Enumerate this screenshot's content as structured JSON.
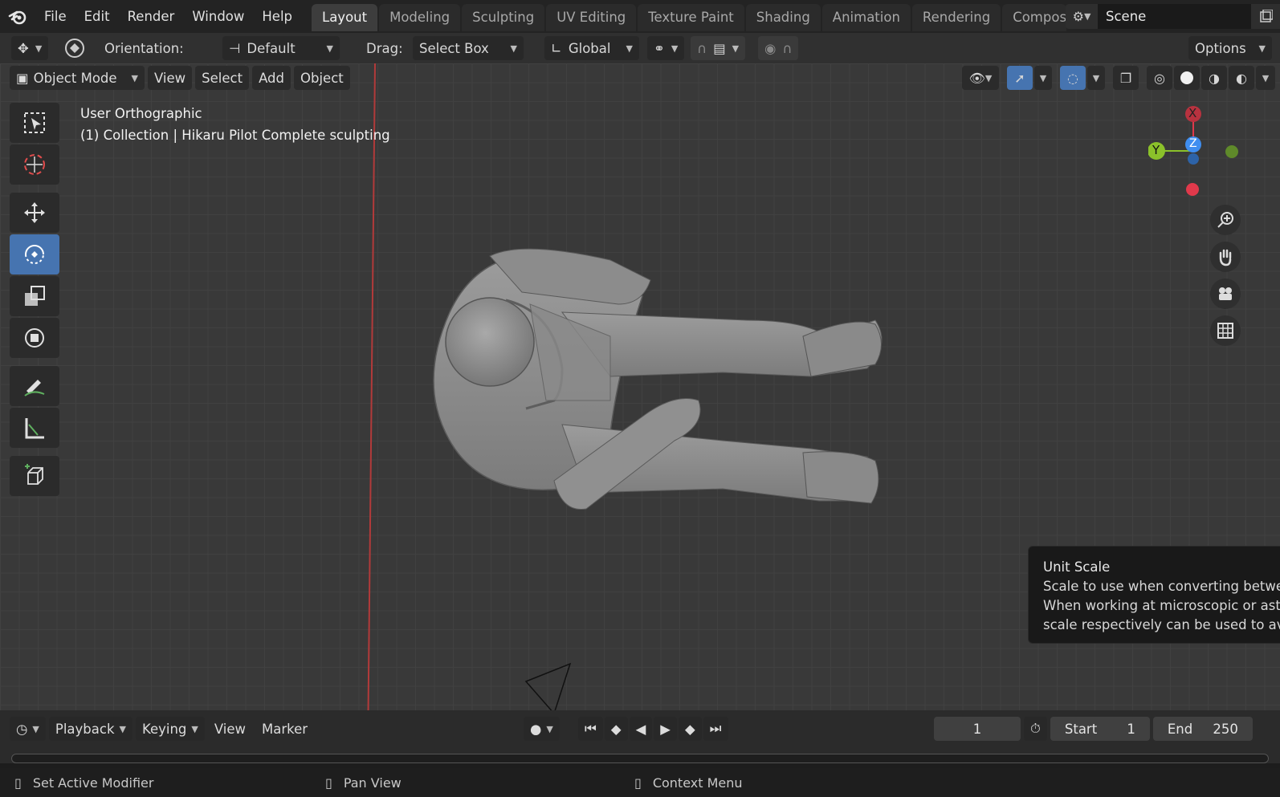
{
  "menu": [
    "File",
    "Edit",
    "Render",
    "Window",
    "Help"
  ],
  "workspaces": [
    "Layout",
    "Modeling",
    "Sculpting",
    "UV Editing",
    "Texture Paint",
    "Shading",
    "Animation",
    "Rendering",
    "Compos"
  ],
  "active_workspace": "Layout",
  "scene": "Scene",
  "tool_header": {
    "orientation_label": "Orientation:",
    "orientation_value": "Default",
    "drag_label": "Drag:",
    "drag_value": "Select Box",
    "transform_space": "Global",
    "options": "Options"
  },
  "viewport_header": {
    "mode": "Object Mode",
    "view": "View",
    "select": "Select",
    "add": "Add",
    "object": "Object"
  },
  "viewport_info": {
    "projection": "User Orthographic",
    "collection": "(1) Collection | Hikaru Pilot Complete sculpting"
  },
  "gizmo": {
    "x": "X",
    "y": "Y",
    "z": "Z"
  },
  "tooltip": {
    "title": "Unit Scale",
    "line1": "Scale to use when converting betwee",
    "line2": "When working at microscopic or astro",
    "line3": "scale respectively can be used to avo"
  },
  "timeline": {
    "playback": "Playback",
    "keying": "Keying",
    "view": "View",
    "marker": "Marker",
    "current_frame": "1",
    "start_label": "Start",
    "start_value": "1",
    "end_label": "End",
    "end_value": "250"
  },
  "statusbar": {
    "left": "Set Active Modifier",
    "middle": "Pan View",
    "right": "Context Menu"
  },
  "colors": {
    "accent": "#4674b0",
    "x_axis": "#e0394b",
    "y_axis": "#8bc12a",
    "z_axis": "#3f8ef0"
  }
}
